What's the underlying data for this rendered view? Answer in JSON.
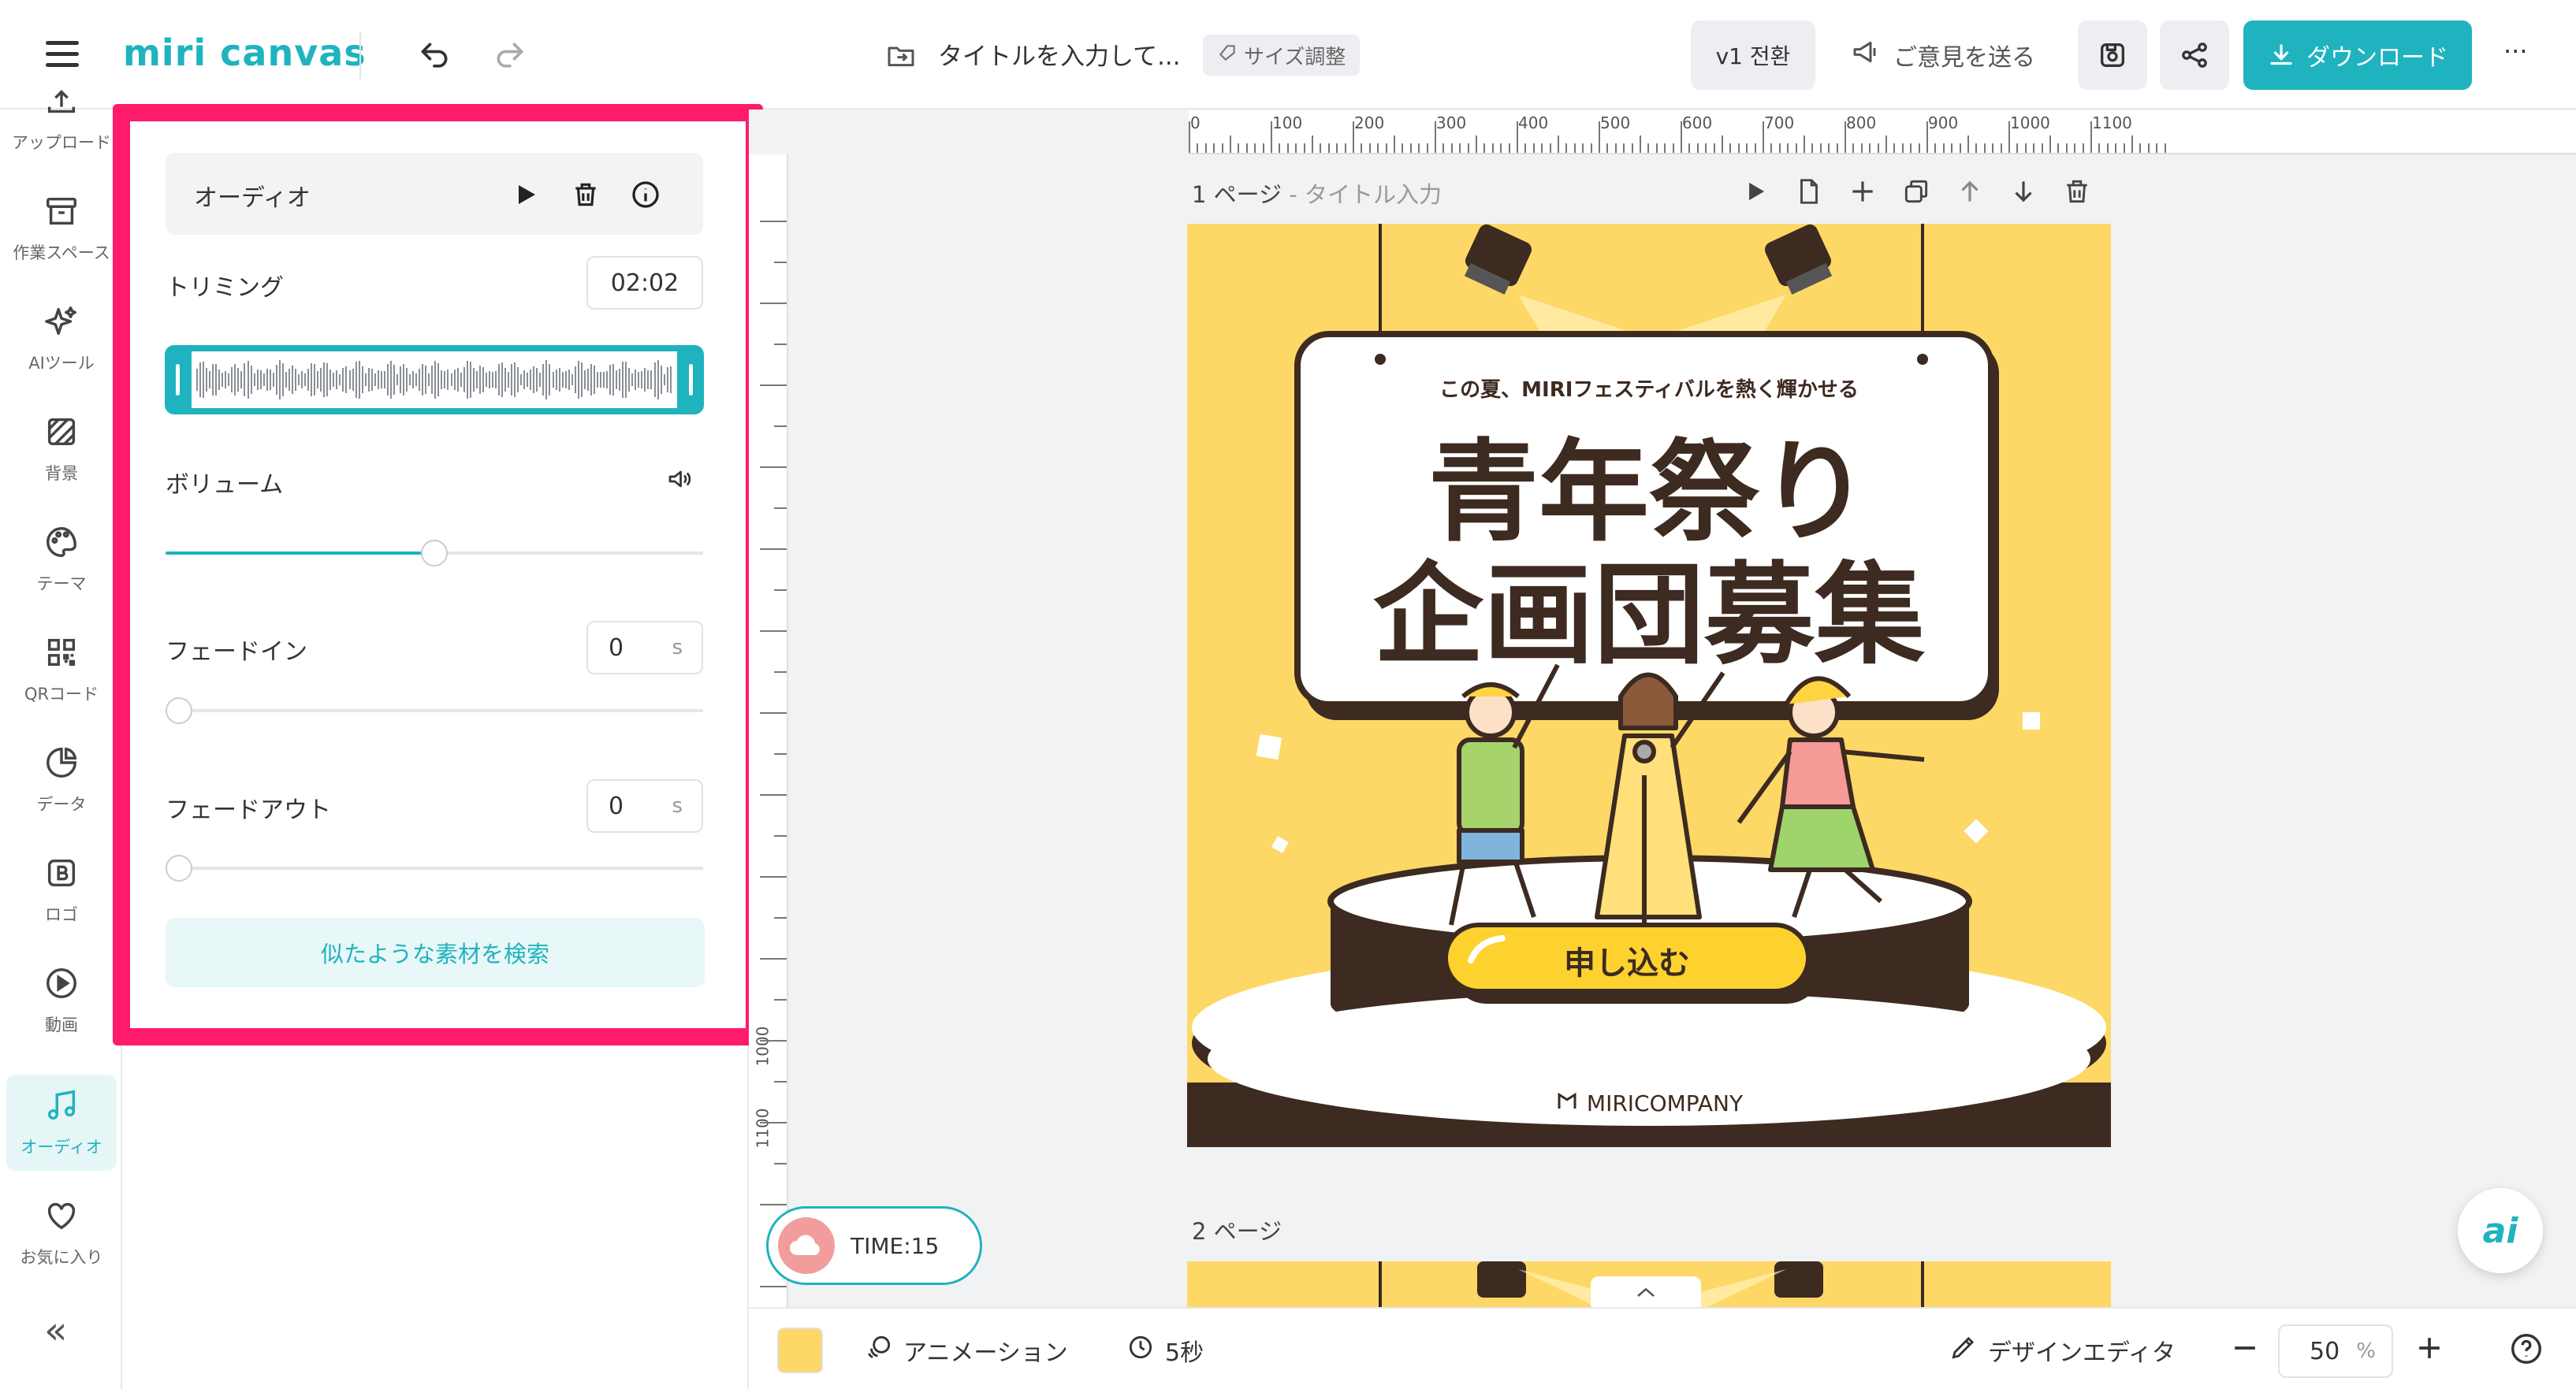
{
  "app": {
    "logo": "miri canvas"
  },
  "header": {
    "doc_title": "タイトルを入力して...",
    "size_adjust": "サイズ調整",
    "v1_label": "v1 전환",
    "feedback": "ご意見を送る",
    "download": "ダウンロード",
    "more": "···"
  },
  "rail": {
    "items": [
      {
        "label": "アップロード",
        "icon": "upload-icon"
      },
      {
        "label": "作業スペース",
        "icon": "archive-icon"
      },
      {
        "label": "AIツール",
        "icon": "sparkle-icon"
      },
      {
        "label": "背景",
        "icon": "pattern-icon"
      },
      {
        "label": "テーマ",
        "icon": "palette-icon"
      },
      {
        "label": "QRコード",
        "icon": "qr-icon"
      },
      {
        "label": "データ",
        "icon": "pie-chart-icon"
      },
      {
        "label": "ロゴ",
        "icon": "logo-b-icon"
      },
      {
        "label": "動画",
        "icon": "play-circle-icon"
      },
      {
        "label": "オーディオ",
        "icon": "music-note-icon"
      },
      {
        "label": "お気に入り",
        "icon": "heart-icon"
      }
    ],
    "active": "オーディオ",
    "collapse": "«"
  },
  "panel": {
    "audio_title": "オーディオ",
    "trim_label": "トリミング",
    "trim_value": "02:02",
    "volume_label": "ボリューム",
    "volume_level": 0.5,
    "fadein_label": "フェードイン",
    "fadein_value": "0",
    "fadein_unit": "s",
    "fadeout_label": "フェードアウト",
    "fadeout_value": "0",
    "fadeout_unit": "s",
    "search_similar": "似たような素材を検索"
  },
  "canvas": {
    "ruler_top": [
      "0",
      "100",
      "200",
      "300",
      "400",
      "500",
      "600",
      "700",
      "800",
      "900",
      "1000",
      "1100"
    ],
    "ruler_left": [
      "1000",
      "1100"
    ],
    "page1_label": "1 ページ",
    "page1_sub": " - タイトル入力",
    "page2_label": "2 ページ",
    "design": {
      "subtitle": "この夏、MIRIフェスティバルを熱く輝かせる",
      "title_line1": "青年祭り",
      "title_line2": "企画団募集",
      "cta": "申し込む",
      "brand": "MIRICOMPANY",
      "bg_color": "#fdd866",
      "dark_color": "#3d2a20"
    },
    "timer": "TIME:15"
  },
  "bottom": {
    "animation": "アニメーション",
    "duration": "5秒",
    "design_editor": "デザインエディタ",
    "zoom": "50",
    "zoom_unit": "%"
  },
  "colors": {
    "accent": "#1fb3bf",
    "highlight": "#ff1b6b"
  }
}
